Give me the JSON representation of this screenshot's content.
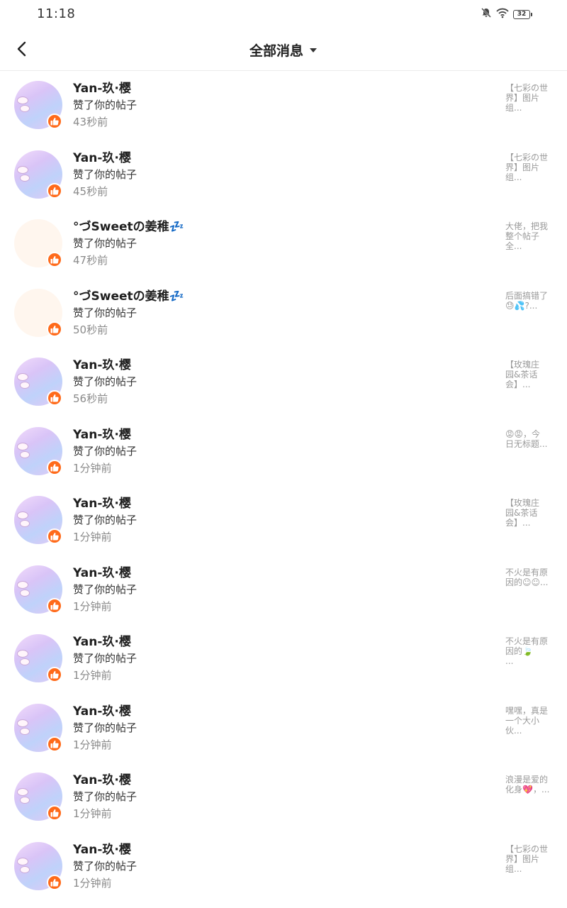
{
  "status_bar": {
    "time": "11:18",
    "battery": "32",
    "icons": [
      "bell-muted-icon",
      "wifi-icon",
      "battery-icon"
    ]
  },
  "header": {
    "back_icon": "chevron-left-icon",
    "title": "全部消息",
    "dropdown_icon": "caret-down-icon"
  },
  "colors": {
    "badge": "#ff6a1a",
    "divider": "#ececec",
    "secondary_text": "#8a8a8a"
  },
  "notifications": [
    {
      "name": "Yan-玖·樱",
      "action": "赞了你的帖子",
      "time": "43秒前",
      "preview": "【七彩の世\n界】图片\n组...",
      "avatar": "purple"
    },
    {
      "name": "Yan-玖·樱",
      "action": "赞了你的帖子",
      "time": "45秒前",
      "preview": "【七彩の世\n界】图片\n组...",
      "avatar": "purple"
    },
    {
      "name": "°づSweetの姜稚💤",
      "action": "赞了你的帖子",
      "time": "47秒前",
      "preview": "大佬，把我\n整个帖子\n全...",
      "avatar": "peach"
    },
    {
      "name": "°づSweetの姜稚💤",
      "action": "赞了你的帖子",
      "time": "50秒前",
      "preview": "后面搞错了\n😓💦?...",
      "avatar": "peach"
    },
    {
      "name": "Yan-玖·樱",
      "action": "赞了你的帖子",
      "time": "56秒前",
      "preview": "【玫瑰庄\n园&茶话\n会】...",
      "avatar": "purple"
    },
    {
      "name": "Yan-玖·樱",
      "action": "赞了你的帖子",
      "time": "1分钟前",
      "preview": "😡😡，今\n日无标题...",
      "avatar": "purple"
    },
    {
      "name": "Yan-玖·樱",
      "action": "赞了你的帖子",
      "time": "1分钟前",
      "preview": "【玫瑰庄\n园&茶话\n会】...",
      "avatar": "purple"
    },
    {
      "name": "Yan-玖·樱",
      "action": "赞了你的帖子",
      "time": "1分钟前",
      "preview": "不火是有原\n因的☺☺...",
      "avatar": "purple"
    },
    {
      "name": "Yan-玖·樱",
      "action": "赞了你的帖子",
      "time": "1分钟前",
      "preview": "不火是有原\n因的🍃\n...",
      "avatar": "purple"
    },
    {
      "name": "Yan-玖·樱",
      "action": "赞了你的帖子",
      "time": "1分钟前",
      "preview": "嘿嘿，真是\n一个大小\n伙...",
      "avatar": "purple"
    },
    {
      "name": "Yan-玖·樱",
      "action": "赞了你的帖子",
      "time": "1分钟前",
      "preview": "浪漫是爱的\n化身💖，...",
      "avatar": "purple"
    },
    {
      "name": "Yan-玖·樱",
      "action": "赞了你的帖子",
      "time": "1分钟前",
      "preview": "【七彩の世\n界】图片\n组...",
      "avatar": "purple"
    }
  ]
}
